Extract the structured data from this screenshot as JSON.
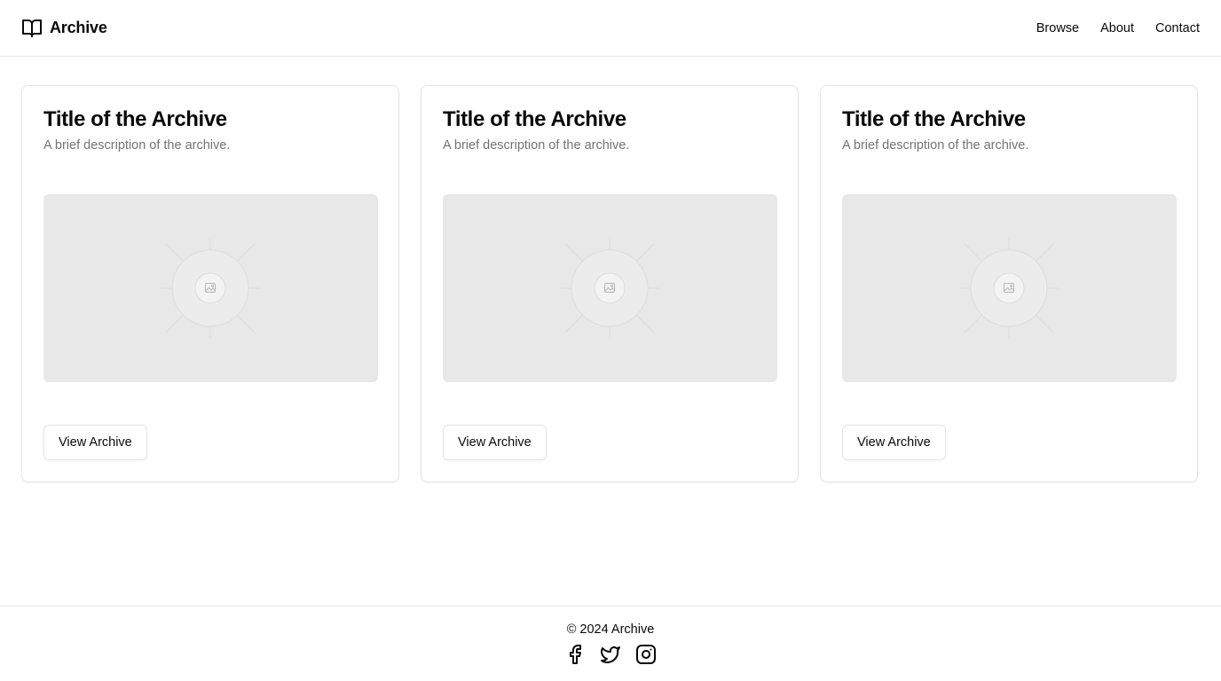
{
  "header": {
    "brand_name": "Archive",
    "brand_icon": "book-open-icon",
    "nav": [
      {
        "label": "Browse"
      },
      {
        "label": "About"
      },
      {
        "label": "Contact"
      }
    ]
  },
  "cards": [
    {
      "title": "Title of the Archive",
      "description": "A brief description of the archive.",
      "image_icon": "image-placeholder-icon",
      "button_label": "View Archive"
    },
    {
      "title": "Title of the Archive",
      "description": "A brief description of the archive.",
      "image_icon": "image-placeholder-icon",
      "button_label": "View Archive"
    },
    {
      "title": "Title of the Archive",
      "description": "A brief description of the archive.",
      "image_icon": "image-placeholder-icon",
      "button_label": "View Archive"
    }
  ],
  "footer": {
    "copyright": "© 2024 Archive",
    "social": [
      {
        "icon": "facebook-icon"
      },
      {
        "icon": "twitter-icon"
      },
      {
        "icon": "instagram-icon"
      }
    ]
  },
  "colors": {
    "text": "#0a0a0a",
    "muted_text": "#737373",
    "border": "#e5e5e5",
    "placeholder_bg": "#e8e8e8"
  }
}
